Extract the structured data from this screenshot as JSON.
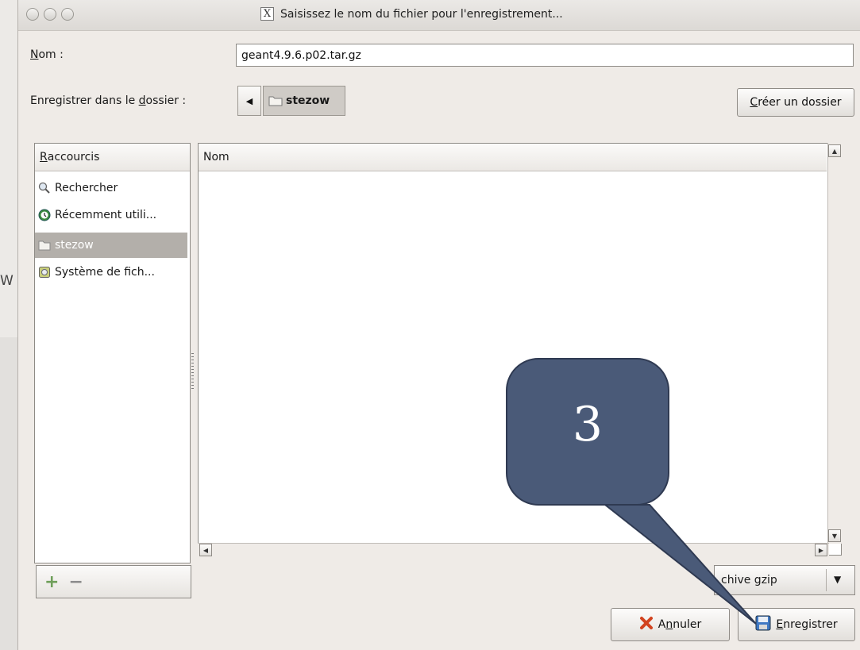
{
  "dialog": {
    "title": "Saisissez le nom du fichier pour l'enregistrement...",
    "title_icon": "X"
  },
  "name_field": {
    "label_mnemonic": "N",
    "label_rest": "om :",
    "value": "geant4.9.6.p02.tar.gz"
  },
  "folder_row": {
    "label_before": "Enregistrer dans le ",
    "label_mnemonic": "d",
    "label_after": "ossier :",
    "back_arrow": "◀",
    "current_folder": "stezow",
    "create_folder_mnemonic": "C",
    "create_folder_rest": "réer un dossier"
  },
  "shortcuts": {
    "header_mnemonic": "R",
    "header_rest": "accourcis",
    "items": [
      {
        "label": "Rechercher",
        "icon": "search-icon"
      },
      {
        "label": "Récemment utili...",
        "icon": "recent-icon"
      },
      {
        "label": "stezow",
        "icon": "folder-icon",
        "selected": true
      },
      {
        "label": "Système de fich...",
        "icon": "filesystem-icon"
      }
    ],
    "add_symbol": "+",
    "remove_symbol": "−"
  },
  "files": {
    "column_header": "Nom"
  },
  "filter": {
    "visible_text": "chive gzip",
    "arrow": "▼"
  },
  "buttons": {
    "cancel_before": "A",
    "cancel_mnemonic": "n",
    "cancel_after": "nuler",
    "save_mnemonic": "E",
    "save_rest": "nregistrer"
  },
  "callout": {
    "number": "3",
    "color": "#4a5a78"
  },
  "background": {
    "stray_letter": "W"
  }
}
